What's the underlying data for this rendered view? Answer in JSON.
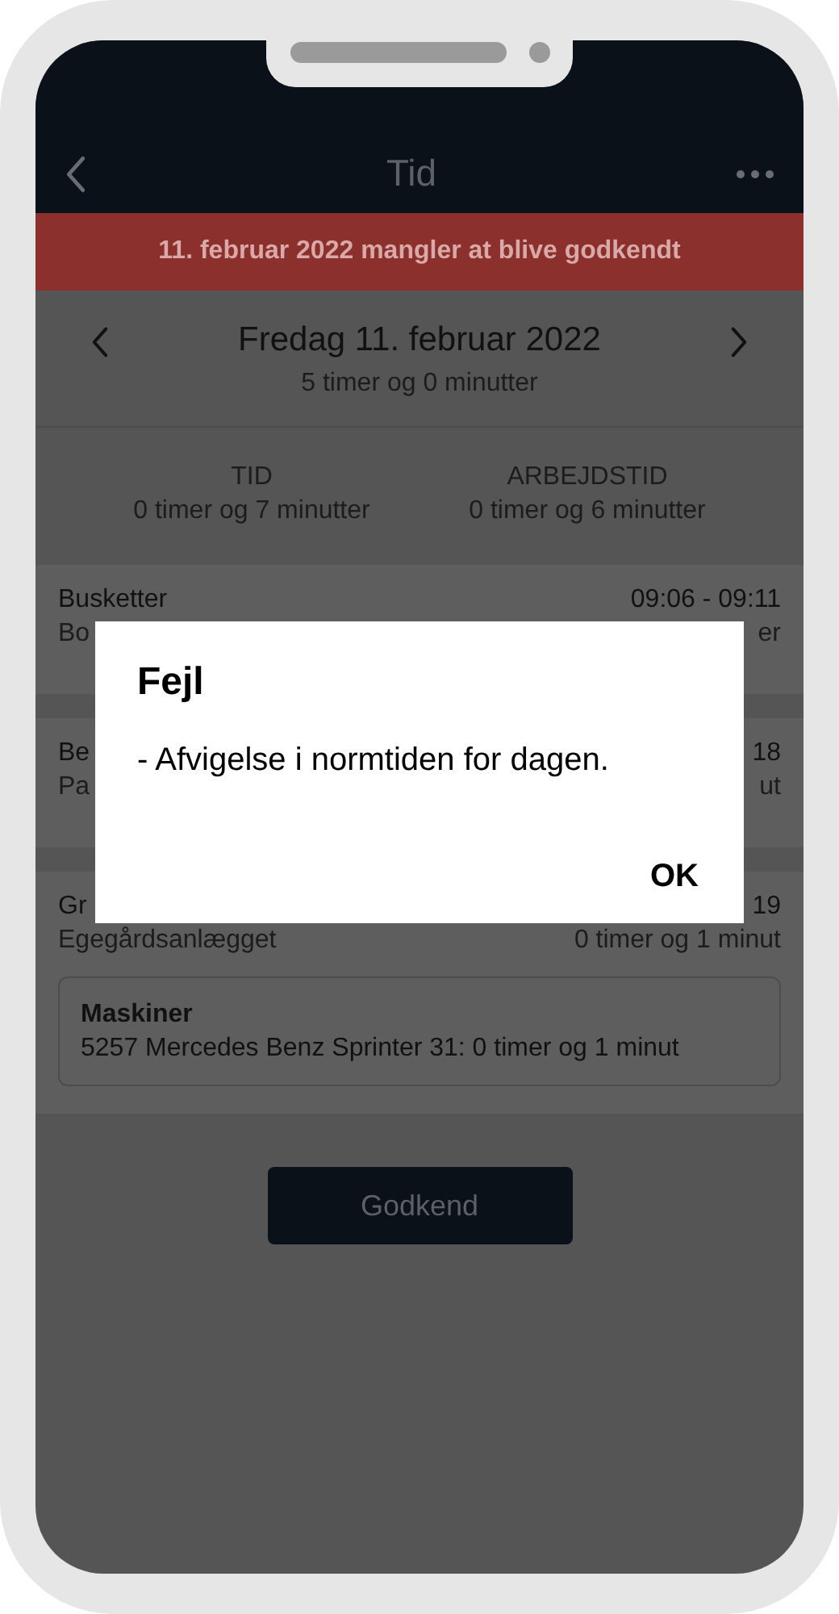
{
  "header": {
    "title": "Tid"
  },
  "banner": "11. februar 2022 mangler at blive godkendt",
  "day": {
    "date": "Fredag 11. februar 2022",
    "total": "5 timer og 0 minutter"
  },
  "totals": [
    {
      "label": "TID",
      "value": "0 timer og 7 minutter"
    },
    {
      "label": "ARBEJDSTID",
      "value": "0 timer og 6 minutter"
    }
  ],
  "entries": [
    {
      "title": "Busketter",
      "time": "09:06 - 09:11",
      "subtitle": "Bo",
      "duration": "er"
    },
    {
      "title": "Be",
      "time": "18",
      "subtitle": "Pa",
      "duration": "ut"
    },
    {
      "title": "Gr",
      "time": "19",
      "subtitle": "Egegårdsanlægget",
      "duration": "0 timer og 1 minut",
      "machines": {
        "heading": "Maskiner",
        "lines": [
          "5257 Mercedes Benz Sprinter 31: 0 timer og 1 minut"
        ]
      }
    }
  ],
  "approve_button": "Godkend",
  "dialog": {
    "title": "Fejl",
    "message": "- Afvigelse i normtiden for dagen.",
    "button": "OK"
  }
}
